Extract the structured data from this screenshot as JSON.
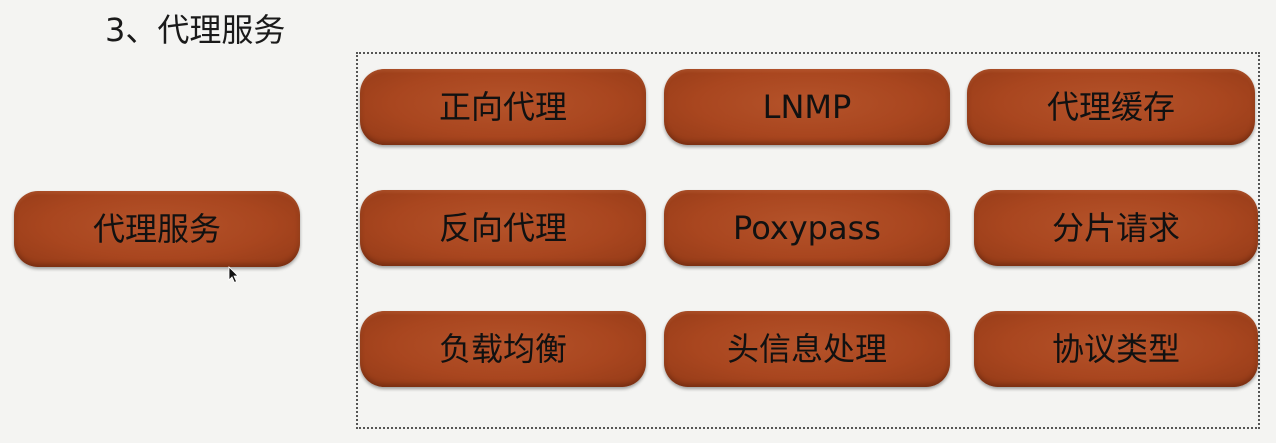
{
  "title": "3、代理服务",
  "root": {
    "label": "代理服务"
  },
  "items": [
    {
      "label": "正向代理"
    },
    {
      "label": "LNMP"
    },
    {
      "label": "代理缓存"
    },
    {
      "label": "反向代理"
    },
    {
      "label": "Poxypass"
    },
    {
      "label": "分片请求"
    },
    {
      "label": "负载均衡"
    },
    {
      "label": "头信息处理"
    },
    {
      "label": "协议类型"
    }
  ],
  "colors": {
    "node_fill": "#a9461f",
    "background": "#f4f4f2",
    "text": "#111111"
  }
}
